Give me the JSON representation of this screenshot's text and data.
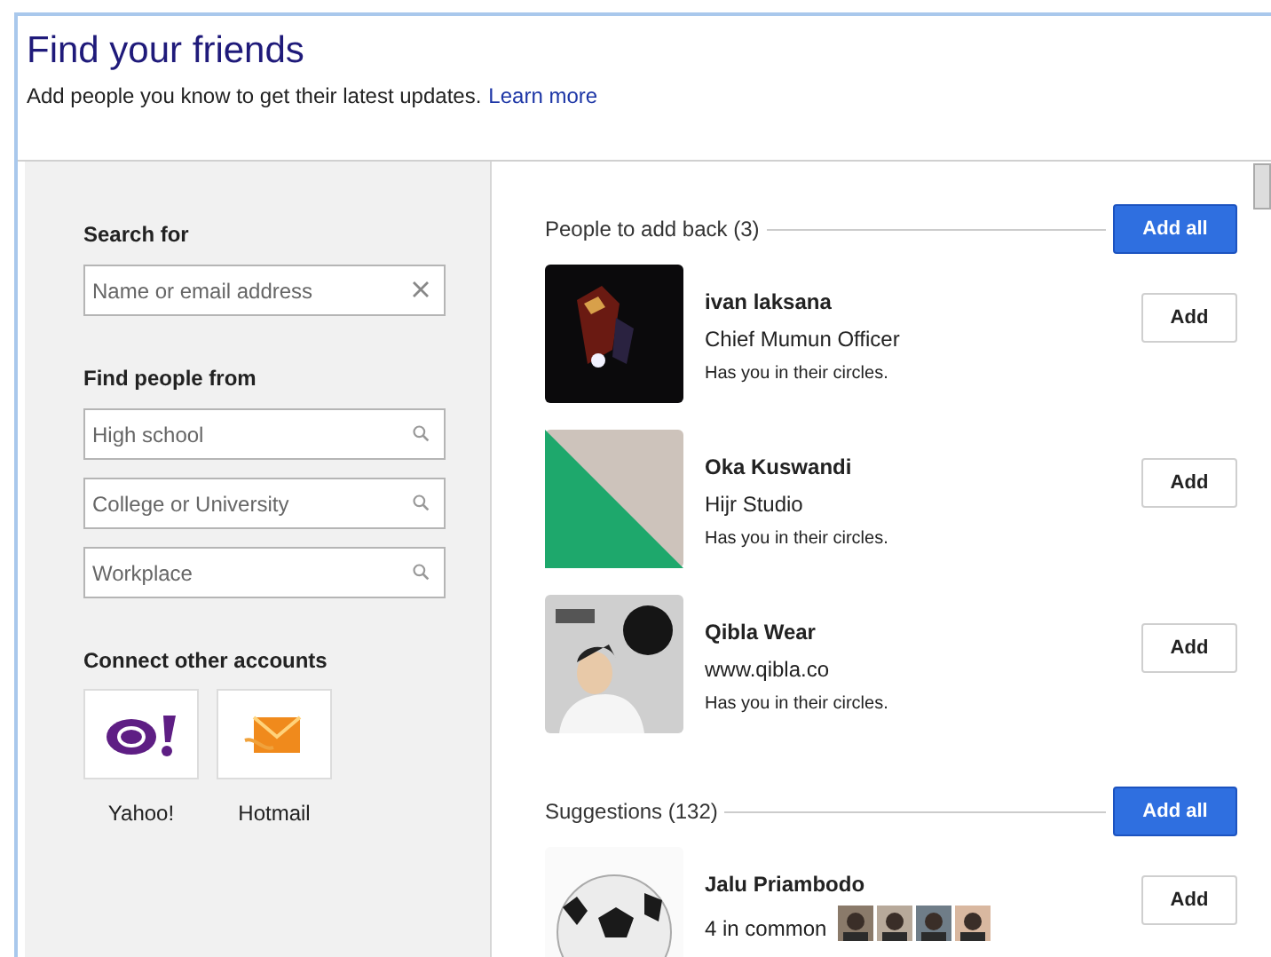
{
  "header": {
    "title": "Find your friends",
    "subtitle": "Add people you know to get their latest updates.",
    "link": "Learn more"
  },
  "search": {
    "heading": "Search for",
    "field": {
      "placeholder": "Name or email address"
    }
  },
  "find_from": {
    "heading": "Find people from",
    "fields": [
      {
        "placeholder": "High school"
      },
      {
        "placeholder": "College or University"
      },
      {
        "placeholder": "Workplace"
      }
    ]
  },
  "connect": {
    "heading": "Connect other accounts",
    "accounts": [
      {
        "label": "Yahoo!",
        "kind": "yahoo"
      },
      {
        "label": "Hotmail",
        "kind": "hotmail"
      }
    ]
  },
  "groups": [
    {
      "title": "People to add back (3)",
      "button": "Add all",
      "people": [
        {
          "name": "ivan laksana",
          "detail": "Chief Mumun Officer",
          "note": "Has you in their circles.",
          "button": "Add"
        },
        {
          "name": "Oka Kuswandi",
          "detail": "Hijr Studio",
          "note": "Has you in their circles.",
          "button": "Add"
        },
        {
          "name": "Qibla Wear",
          "detail": "www.qibla.co",
          "note": "Has you in their circles.",
          "button": "Add"
        }
      ]
    },
    {
      "title": "Suggestions (132)",
      "button": "Add all",
      "people": [
        {
          "name": "Jalu Priambodo",
          "common": "4 in common",
          "button": "Add"
        }
      ]
    }
  ]
}
